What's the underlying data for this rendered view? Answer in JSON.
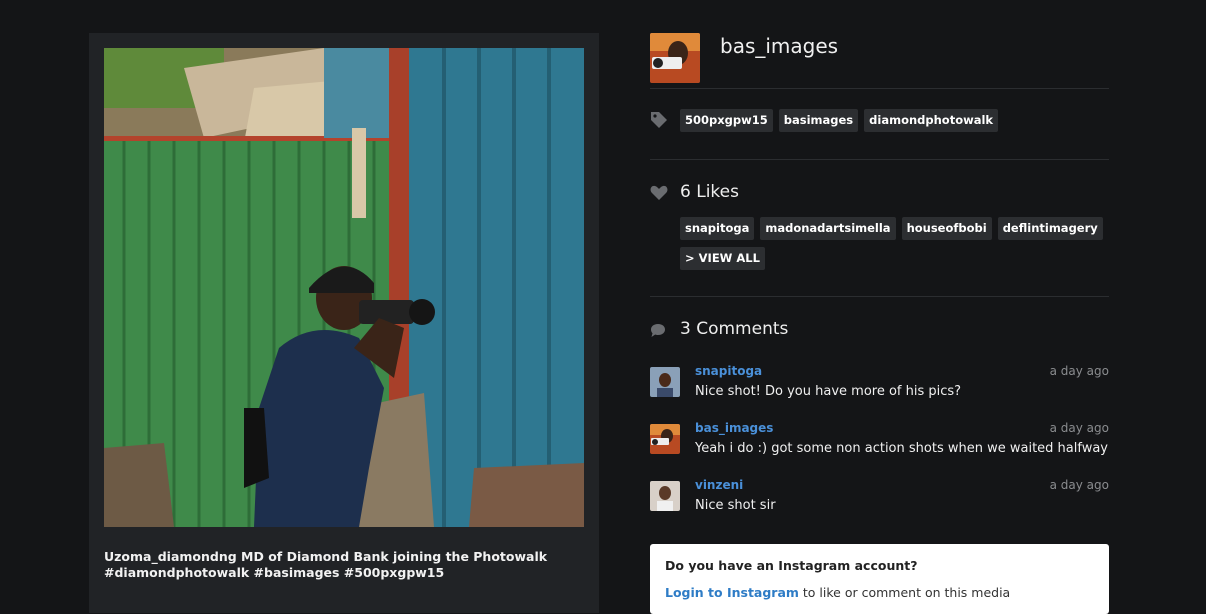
{
  "post": {
    "caption": "Uzoma_diamondng MD of Diamond Bank joining the Photowalk #diamondphotowalk #basimages #500pxgpw15"
  },
  "author": {
    "username": "bas_images"
  },
  "tags": [
    "500pxgpw15",
    "basimages",
    "diamondphotowalk"
  ],
  "likes": {
    "label": "6 Likes",
    "users": [
      "snapitoga",
      "madonadartsimella",
      "houseofbobi",
      "deflintimagery"
    ],
    "view_all_label": "> VIEW ALL"
  },
  "comments": {
    "label": "3 Comments",
    "items": [
      {
        "user": "snapitoga",
        "time": "a day ago",
        "text": "Nice shot! Do you have more of his pics?"
      },
      {
        "user": "bas_images",
        "time": "a day ago",
        "text": "Yeah i do :) got some non action shots when we waited halfway"
      },
      {
        "user": "vinzeni",
        "time": "a day ago",
        "text": "Nice shot sir"
      }
    ]
  },
  "instagram_prompt": {
    "question": "Do you have an Instagram account?",
    "login_label": "Login to Instagram",
    "rest_text": " to like or comment on this media"
  },
  "icons": {
    "tag": "tag-icon",
    "likes": "heart-icon",
    "comments": "speech-bubble-icon"
  },
  "colors": {
    "background": "#141517",
    "card": "#212326",
    "chip": "#2c2e31",
    "link": "#4a90d9"
  }
}
